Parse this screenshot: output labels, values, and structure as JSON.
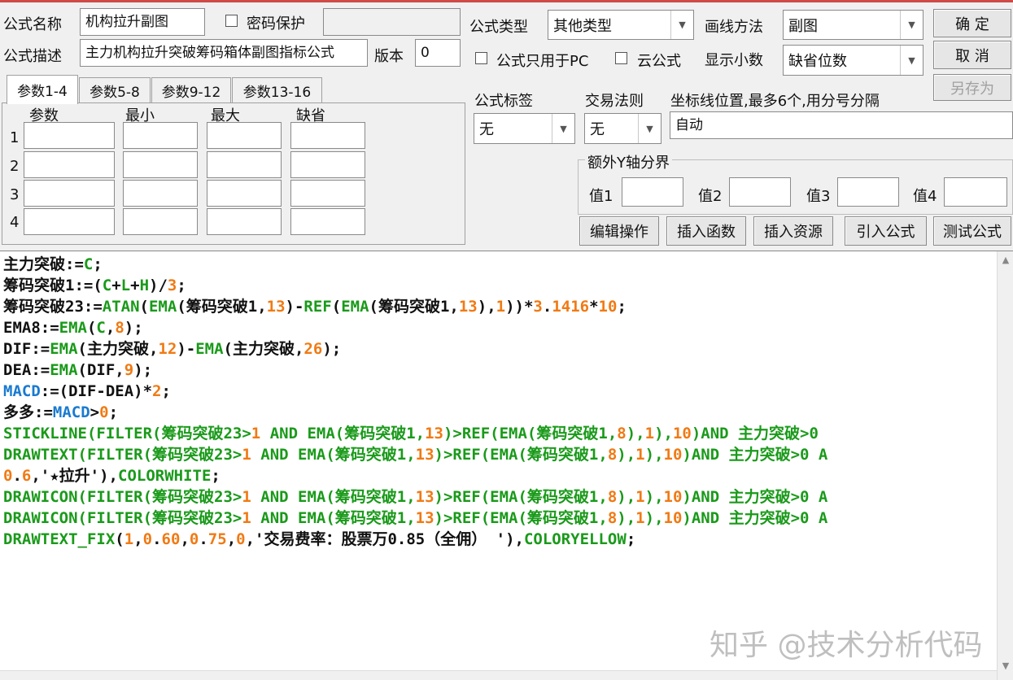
{
  "header": {
    "name_label": "公式名称",
    "name_value": "机构拉升副图",
    "password_label": "密码保护",
    "password_value": "",
    "desc_label": "公式描述",
    "desc_value": "主力机构拉升突破筹码箱体副图指标公式",
    "version_label": "版本",
    "version_value": "0",
    "type_label": "公式类型",
    "type_value": "其他类型",
    "draw_label": "画线方法",
    "draw_value": "副图",
    "pc_only_label": "公式只用于PC",
    "cloud_label": "云公式",
    "decimals_label": "显示小数",
    "decimals_value": "缺省位数"
  },
  "buttons": {
    "ok": "确  定",
    "cancel": "取  消",
    "save_as": "另存为",
    "edit_ops": "编辑操作",
    "insert_func": "插入函数",
    "insert_res": "插入资源",
    "import_formula": "引入公式",
    "test_formula": "测试公式"
  },
  "tabs": [
    "参数1-4",
    "参数5-8",
    "参数9-12",
    "参数13-16"
  ],
  "params": {
    "headers": [
      "参数",
      "最小",
      "最大",
      "缺省"
    ],
    "rows": [
      "1",
      "2",
      "3",
      "4"
    ]
  },
  "right": {
    "tag_label": "公式标签",
    "tag_value": "无",
    "rule_label": "交易法则",
    "rule_value": "无",
    "coord_label": "坐标线位置,最多6个,用分号分隔",
    "coord_value": "自动",
    "yaxis_label": "额外Y轴分界",
    "v1": "值1",
    "v2": "值2",
    "v3": "值3",
    "v4": "值4"
  },
  "colors": {
    "black": "#111111",
    "green": "#1a9a1a",
    "orange": "#f07a14",
    "blue": "#1a7ad0"
  },
  "code_lines": [
    [
      [
        "主力突破:=",
        "black"
      ],
      [
        "C",
        "green"
      ],
      [
        ";",
        "black"
      ]
    ],
    [
      [
        "筹码突破1:=(",
        "black"
      ],
      [
        "C",
        "green"
      ],
      [
        "+",
        "black"
      ],
      [
        "L",
        "green"
      ],
      [
        "+",
        "black"
      ],
      [
        "H",
        "green"
      ],
      [
        ")/",
        "black"
      ],
      [
        "3",
        "orange"
      ],
      [
        ";",
        "black"
      ]
    ],
    [
      [
        "筹码突破23:=",
        "black"
      ],
      [
        "ATAN",
        "green"
      ],
      [
        "(",
        "black"
      ],
      [
        "EMA",
        "green"
      ],
      [
        "(筹码突破1,",
        "black"
      ],
      [
        "13",
        "orange"
      ],
      [
        ")-",
        "black"
      ],
      [
        "REF",
        "green"
      ],
      [
        "(",
        "black"
      ],
      [
        "EMA",
        "green"
      ],
      [
        "(筹码突破1,",
        "black"
      ],
      [
        "13",
        "orange"
      ],
      [
        "),",
        "black"
      ],
      [
        "1",
        "orange"
      ],
      [
        "))*",
        "black"
      ],
      [
        "3",
        "orange"
      ],
      [
        ".",
        "black"
      ],
      [
        "1416",
        "orange"
      ],
      [
        "*",
        "black"
      ],
      [
        "10",
        "orange"
      ],
      [
        ";",
        "black"
      ]
    ],
    [
      [
        "EMA8:=",
        "black"
      ],
      [
        "EMA",
        "green"
      ],
      [
        "(",
        "black"
      ],
      [
        "C",
        "green"
      ],
      [
        ",",
        "black"
      ],
      [
        "8",
        "orange"
      ],
      [
        ");",
        "black"
      ]
    ],
    [
      [
        "DIF:=",
        "black"
      ],
      [
        "EMA",
        "green"
      ],
      [
        "(主力突破,",
        "black"
      ],
      [
        "12",
        "orange"
      ],
      [
        ")-",
        "black"
      ],
      [
        "EMA",
        "green"
      ],
      [
        "(主力突破,",
        "black"
      ],
      [
        "26",
        "orange"
      ],
      [
        ");",
        "black"
      ]
    ],
    [
      [
        "DEA:=",
        "black"
      ],
      [
        "EMA",
        "green"
      ],
      [
        "(DIF,",
        "black"
      ],
      [
        "9",
        "orange"
      ],
      [
        ");",
        "black"
      ]
    ],
    [
      [
        "MACD",
        "blue"
      ],
      [
        ":=(DIF-DEA)*",
        "black"
      ],
      [
        "2",
        "orange"
      ],
      [
        ";",
        "black"
      ]
    ],
    [
      [
        "多多:=",
        "black"
      ],
      [
        "MACD",
        "blue"
      ],
      [
        ">",
        "black"
      ],
      [
        "0",
        "orange"
      ],
      [
        ";",
        "black"
      ]
    ],
    [
      [
        "STICKLINE",
        "green"
      ],
      [
        "(FILTER(筹码突破23>",
        "green"
      ],
      [
        "1",
        "orange"
      ],
      [
        " AND EMA(筹码突破1,",
        "green"
      ],
      [
        "13",
        "orange"
      ],
      [
        ")>REF(EMA(筹码突破1,",
        "green"
      ],
      [
        "8",
        "orange"
      ],
      [
        "),",
        "green"
      ],
      [
        "1",
        "orange"
      ],
      [
        "),",
        "green"
      ],
      [
        "10",
        "orange"
      ],
      [
        ")AND 主力突破>0",
        "green"
      ]
    ],
    [
      [
        "DRAWTEXT",
        "green"
      ],
      [
        "(FILTER(筹码突破23>",
        "green"
      ],
      [
        "1",
        "orange"
      ],
      [
        " AND EMA(筹码突破1,",
        "green"
      ],
      [
        "13",
        "orange"
      ],
      [
        ")>REF(EMA(筹码突破1,",
        "green"
      ],
      [
        "8",
        "orange"
      ],
      [
        "),",
        "green"
      ],
      [
        "1",
        "orange"
      ],
      [
        "),",
        "green"
      ],
      [
        "10",
        "orange"
      ],
      [
        ")AND 主力突破>0 A",
        "green"
      ]
    ],
    [
      [
        "0",
        "orange"
      ],
      [
        ".",
        "black"
      ],
      [
        "6",
        "orange"
      ],
      [
        ",'★拉升'),",
        "black"
      ],
      [
        "COLORWHITE",
        "green"
      ],
      [
        ";",
        "black"
      ]
    ],
    [
      [
        "DRAWICON",
        "green"
      ],
      [
        "(FILTER(筹码突破23>",
        "green"
      ],
      [
        "1",
        "orange"
      ],
      [
        " AND EMA(筹码突破1,",
        "green"
      ],
      [
        "13",
        "orange"
      ],
      [
        ")>REF(EMA(筹码突破1,",
        "green"
      ],
      [
        "8",
        "orange"
      ],
      [
        "),",
        "green"
      ],
      [
        "1",
        "orange"
      ],
      [
        "),",
        "green"
      ],
      [
        "10",
        "orange"
      ],
      [
        ")AND 主力突破>0 A",
        "green"
      ]
    ],
    [
      [
        "DRAWICON",
        "green"
      ],
      [
        "(FILTER(筹码突破23>",
        "green"
      ],
      [
        "1",
        "orange"
      ],
      [
        " AND EMA(筹码突破1,",
        "green"
      ],
      [
        "13",
        "orange"
      ],
      [
        ")>REF(EMA(筹码突破1,",
        "green"
      ],
      [
        "8",
        "orange"
      ],
      [
        "),",
        "green"
      ],
      [
        "1",
        "orange"
      ],
      [
        "),",
        "green"
      ],
      [
        "10",
        "orange"
      ],
      [
        ")AND 主力突破>0 A",
        "green"
      ]
    ],
    [
      [
        "DRAWTEXT_FIX",
        "green"
      ],
      [
        "(",
        "black"
      ],
      [
        "1",
        "orange"
      ],
      [
        ",",
        "black"
      ],
      [
        "0",
        "orange"
      ],
      [
        ".",
        "black"
      ],
      [
        "60",
        "orange"
      ],
      [
        ",",
        "black"
      ],
      [
        "0",
        "orange"
      ],
      [
        ".",
        "black"
      ],
      [
        "75",
        "orange"
      ],
      [
        ",",
        "black"
      ],
      [
        "0",
        "orange"
      ],
      [
        ",'交易费率：股票万0.85（全佣） '),",
        "black"
      ],
      [
        "COLORYELLOW",
        "green"
      ],
      [
        ";",
        "black"
      ]
    ]
  ],
  "watermark": "知乎 @技术分析代码"
}
